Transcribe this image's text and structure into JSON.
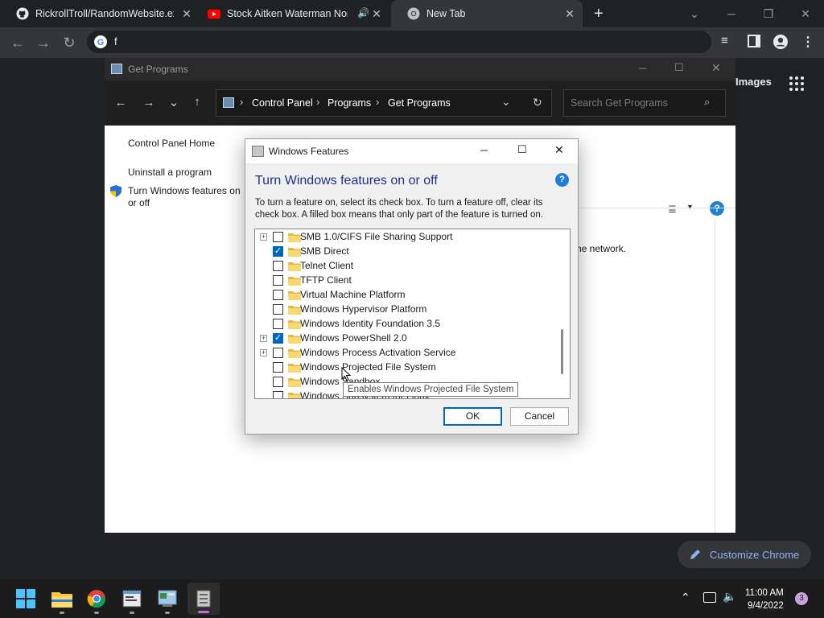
{
  "browser": {
    "tabs": [
      {
        "title": "RickrollTroll/RandomWebsite.exe",
        "favicon": "github-icon"
      },
      {
        "title": "Stock Aitken Waterman Non",
        "favicon": "youtube-icon",
        "audio": true
      },
      {
        "title": "New Tab",
        "favicon": "chrome-icon",
        "active": true
      }
    ],
    "new_tab": "+",
    "omnibox_text": "f"
  },
  "ntp": {
    "images_label": "Images",
    "customize_label": "Customize Chrome"
  },
  "explorer": {
    "window_title": "Get Programs",
    "breadcrumb": [
      "Control Panel",
      "Programs",
      "Get Programs"
    ],
    "search_placeholder": "Search Get Programs",
    "left_links": [
      "Control Panel Home",
      "Uninstall a program",
      "Turn Windows features on or off"
    ],
    "behind_text": "he network."
  },
  "dialog": {
    "title": "Windows Features",
    "heading": "Turn Windows features on or off",
    "description": "To turn a feature on, select its check box. To turn a feature off, clear its check box. A filled box means that only part of the feature is turned on.",
    "features": [
      {
        "label": "SMB 1.0/CIFS File Sharing Support",
        "expandable": true,
        "checked": false
      },
      {
        "label": "SMB Direct",
        "expandable": false,
        "checked": true
      },
      {
        "label": "Telnet Client",
        "expandable": false,
        "checked": false
      },
      {
        "label": "TFTP Client",
        "expandable": false,
        "checked": false
      },
      {
        "label": "Virtual Machine Platform",
        "expandable": false,
        "checked": false
      },
      {
        "label": "Windows Hypervisor Platform",
        "expandable": false,
        "checked": false
      },
      {
        "label": "Windows Identity Foundation 3.5",
        "expandable": false,
        "checked": false
      },
      {
        "label": "Windows PowerShell 2.0",
        "expandable": true,
        "checked": true
      },
      {
        "label": "Windows Process Activation Service",
        "expandable": true,
        "checked": false
      },
      {
        "label": "Windows Projected File System",
        "expandable": false,
        "checked": false
      },
      {
        "label": "Windows Sandbox",
        "expandable": false,
        "checked": false
      },
      {
        "label": "Windows Subsystem for Linux",
        "expandable": false,
        "checked": false
      }
    ],
    "ok_label": "OK",
    "cancel_label": "Cancel",
    "tooltip": "Enables Windows Projected File System"
  },
  "taskbar": {
    "time": "11:00 AM",
    "date": "9/4/2022",
    "notification_count": "3"
  },
  "colors": {
    "dialog_heading": "#1e3287",
    "checkbox_checked": "#0067c0",
    "chrome_dark": "#202124",
    "customize_text": "#8ab4f8"
  }
}
